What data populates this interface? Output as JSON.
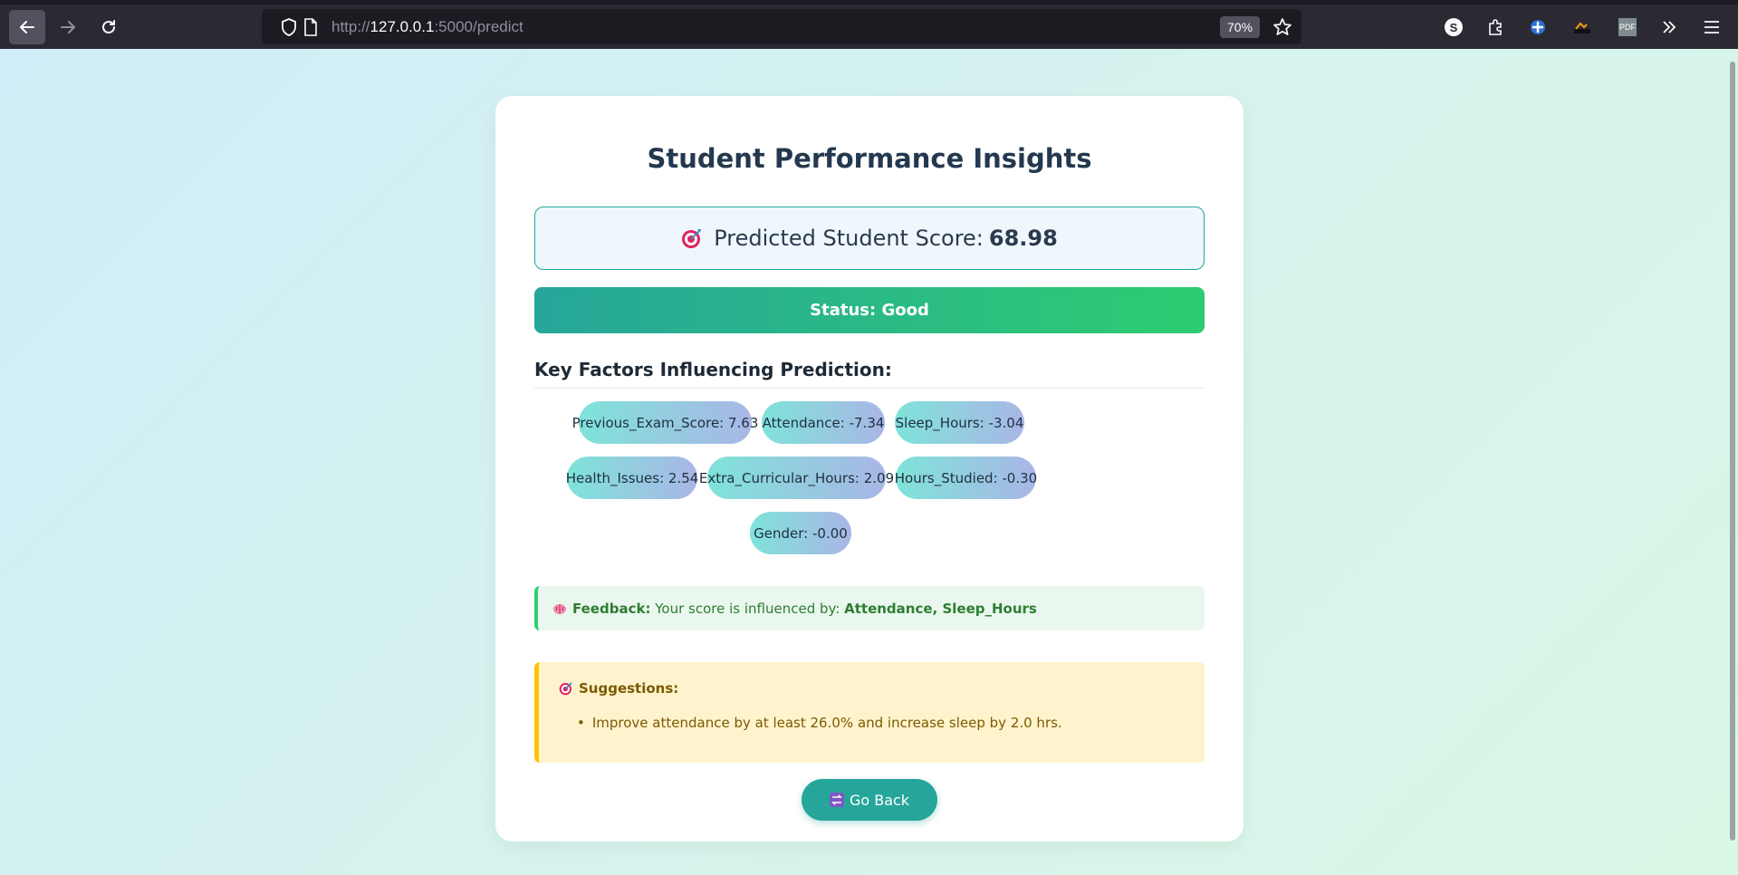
{
  "browser": {
    "url_prefix": "http://",
    "url_host": "127.0.0.1",
    "url_path": ":5000/predict",
    "zoom": "70%",
    "profile_initial": "S",
    "pdf_label": "PDF"
  },
  "page": {
    "title": "Student Performance Insights",
    "score_label": "Predicted Student Score:",
    "score_value": "68.98",
    "status": "Status: Good",
    "factors_heading": "Key Factors Influencing Prediction:",
    "factors": [
      "Previous_Exam_Score: 7.63",
      "Attendance: -7.34",
      "Sleep_Hours: -3.04",
      "Health_Issues: 2.54",
      "Extra_Curricular_Hours: 2.09",
      "Hours_Studied: -0.30",
      "Gender: -0.00"
    ],
    "feedback_label": "Feedback:",
    "feedback_text": "Your score is influenced by:",
    "feedback_factors": "Attendance, Sleep_Hours",
    "suggestions_title": "Suggestions:",
    "suggestions": [
      "Improve attendance by at least 26.0% and increase sleep by 2.0 hrs."
    ],
    "go_back_label": "Go Back"
  },
  "colors": {
    "accent_teal": "#26a69a",
    "status_green": "#2ecc71",
    "warning_yellow": "#ffc107",
    "title_navy": "#24384f"
  },
  "icons": {
    "score": "target-icon",
    "feedback": "brain-icon",
    "suggestions": "target-icon",
    "go_back": "arrows-icon"
  }
}
